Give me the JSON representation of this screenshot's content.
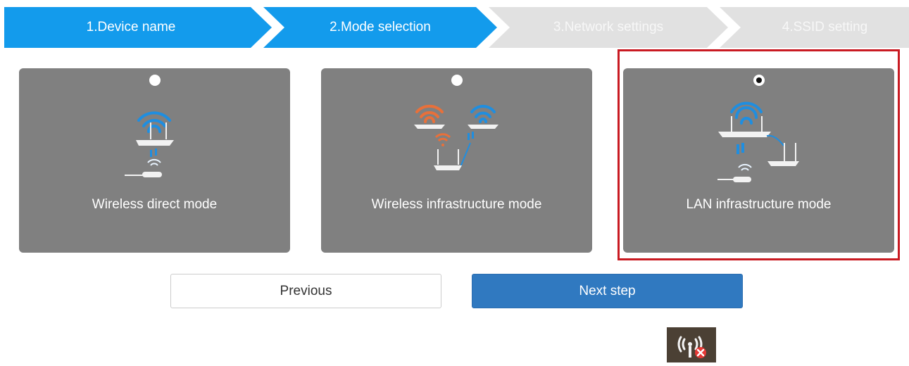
{
  "wizard": {
    "steps": [
      {
        "label": "1.Device name",
        "state": "complete"
      },
      {
        "label": "2.Mode selection",
        "state": "current"
      },
      {
        "label": "3.Network settings",
        "state": "pending"
      },
      {
        "label": "4.SSID setting",
        "state": "pending"
      }
    ],
    "colors": {
      "active": "#139bec",
      "inactive": "#e1e1e1"
    }
  },
  "modes": [
    {
      "label": "Wireless direct mode",
      "selected": false,
      "icon": "router-dongle-icon"
    },
    {
      "label": "Wireless infrastructure mode",
      "selected": false,
      "icon": "router-bridge-icon"
    },
    {
      "label": "LAN infrastructure mode",
      "selected": true,
      "icon": "lan-router-icon"
    }
  ],
  "buttons": {
    "previous": "Previous",
    "next": "Next step"
  },
  "colors": {
    "card": "#808080",
    "highlight": "#c91a22",
    "primary_button": "#3079c0",
    "wifi_blue": "#1f8ee0",
    "wifi_orange": "#e8703a"
  },
  "status_icon": "wireless-disconnected-icon"
}
